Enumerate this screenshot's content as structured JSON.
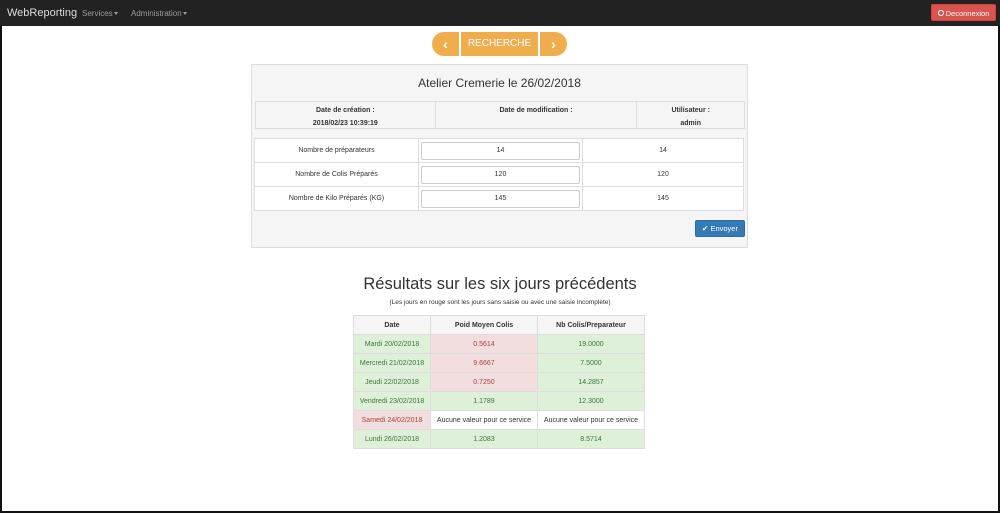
{
  "navbar": {
    "brand": "WebReporting",
    "menu": [
      {
        "label": "Services"
      },
      {
        "label": "Administration"
      }
    ],
    "logout_label": "Deconnexion"
  },
  "pager": {
    "prev_icon": "chevron-left-icon",
    "title": "RECHERCHE",
    "next_icon": "chevron-right-icon",
    "color": "#f0ad4e"
  },
  "panel": {
    "title": "Atelier Cremerie le 26/02/2018",
    "info": {
      "creation_label": "Date de création :",
      "creation_value": "2018/02/23 10:39:19",
      "modification_label": "Date de modification :",
      "modification_value": "",
      "user_label": "Utilisateur :",
      "user_value": "admin"
    },
    "rows": [
      {
        "label": "Nombre de préparateurs",
        "input": "14",
        "value": "14"
      },
      {
        "label": "Nombre de Colis Préparés",
        "input": "120",
        "value": "120"
      },
      {
        "label": "Nombre de Kilo Préparés (KG)",
        "input": "145",
        "value": "145"
      }
    ],
    "submit_label": "Envoyer"
  },
  "results": {
    "title": "Résultats sur les six jours précédents",
    "subtitle": "(Les jours en rouge sont les jours sans saisie ou avec une saisie incomplète)",
    "headers": [
      "Date",
      "Poid Moyen Colis",
      "Nb Colis/Preparateur"
    ],
    "rows": [
      {
        "date": "Mardi 20/02/2018",
        "poids": "0.5614",
        "nb": "19.0000",
        "status": [
          "ok",
          "ko",
          "ok"
        ]
      },
      {
        "date": "Mercredi 21/02/2018",
        "poids": "9.6667",
        "nb": "7.5000",
        "status": [
          "ok",
          "ko",
          "ok"
        ]
      },
      {
        "date": "Jeudi 22/02/2018",
        "poids": "0.7250",
        "nb": "14.2857",
        "status": [
          "ok",
          "ko",
          "ok"
        ]
      },
      {
        "date": "Vendredi 23/02/2018",
        "poids": "1.1789",
        "nb": "12.3000",
        "status": [
          "ok",
          "ok",
          "ok"
        ]
      },
      {
        "date": "Samedi 24/02/2018",
        "poids": "Aucune valeur pour ce service",
        "nb": "Aucune valeur pour ce service",
        "status": [
          "ko",
          "neutral",
          "neutral"
        ]
      },
      {
        "date": "Lundi 26/02/2018",
        "poids": "1.2083",
        "nb": "8.5714",
        "status": [
          "ok",
          "ok",
          "ok"
        ]
      }
    ],
    "colors": {
      "ok_bg": "#dff0d8",
      "ok_text": "#3c763d",
      "ko_bg": "#f2dede",
      "ko_text": "#a94442"
    }
  }
}
